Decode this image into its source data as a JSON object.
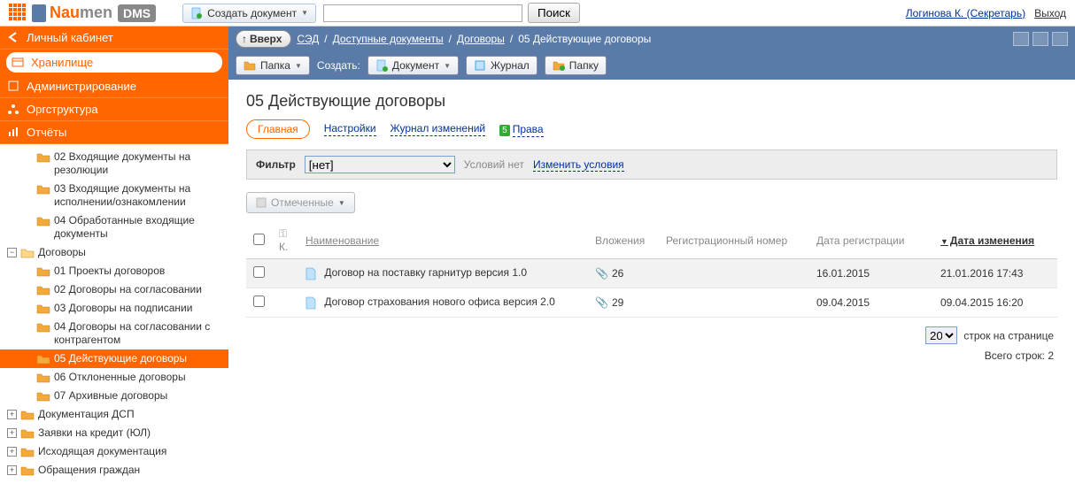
{
  "logo": {
    "name1": "Nau",
    "name2": "men",
    "dms": "DMS"
  },
  "topbar": {
    "create_doc": "Создать документ",
    "search_btn": "Поиск",
    "user_link": "Логинова К. (Секретарь)",
    "exit": "Выход"
  },
  "sidebar_tabs": {
    "personal": "Личный кабинет",
    "storage": "Хранилище",
    "admin": "Администрирование",
    "org": "Оргструктура",
    "reports": "Отчёты"
  },
  "tree": {
    "n02": "02 Входящие документы на резолюции",
    "n03": "03 Входящие документы на исполнении/ознакомлении",
    "n04": "04 Обработанные входящие документы",
    "contracts": "Договоры",
    "c01": "01 Проекты договоров",
    "c02": "02 Договоры на согласовании",
    "c03": "03 Договоры на подписании",
    "c04": "04 Договоры на согласовании с контрагентом",
    "c05": "05 Действующие договоры",
    "c06": "06 Отклоненные договоры",
    "c07": "07 Архивные договоры",
    "dsp": "Документация ДСП",
    "credit": "Заявки на кредит (ЮЛ)",
    "outgoing": "Исходящая документация",
    "appeals": "Обращения граждан"
  },
  "breadcrumb": {
    "up": "Вверх",
    "root": "СЭД",
    "avail": "Доступные документы",
    "contracts": "Договоры",
    "current": "05 Действующие договоры"
  },
  "toolbar": {
    "folder": "Папка",
    "create_label": "Создать:",
    "document": "Документ",
    "journal": "Журнал",
    "folder2": "Папку"
  },
  "page": {
    "title": "05 Действующие договоры",
    "tab_main": "Главная",
    "tab_settings": "Настройки",
    "tab_log": "Журнал изменений",
    "tab_rights_badge": "5",
    "tab_rights": "Права"
  },
  "filter": {
    "label": "Фильтр",
    "selected": "[нет]",
    "no_conditions": "Условий нет",
    "change": "Изменить условия"
  },
  "marked": "Отмеченные",
  "columns": {
    "k": "К.",
    "name": "Наименование",
    "attach": "Вложения",
    "regnum": "Регистрационный номер",
    "regdate": "Дата регистрации",
    "moddate": "Дата изменения"
  },
  "rows": [
    {
      "name": "Договор на поставку гарнитур версия 1.0",
      "attach": "26",
      "regdate": "16.01.2015",
      "moddate": "21.01.2016 17:43"
    },
    {
      "name": "Договор страхования нового офиса версия 2.0",
      "attach": "29",
      "regdate": "09.04.2015",
      "moddate": "09.04.2015 16:20"
    }
  ],
  "pager": {
    "perpage": "20",
    "perpage_label": "строк на странице",
    "total": "Всего строк: 2"
  }
}
